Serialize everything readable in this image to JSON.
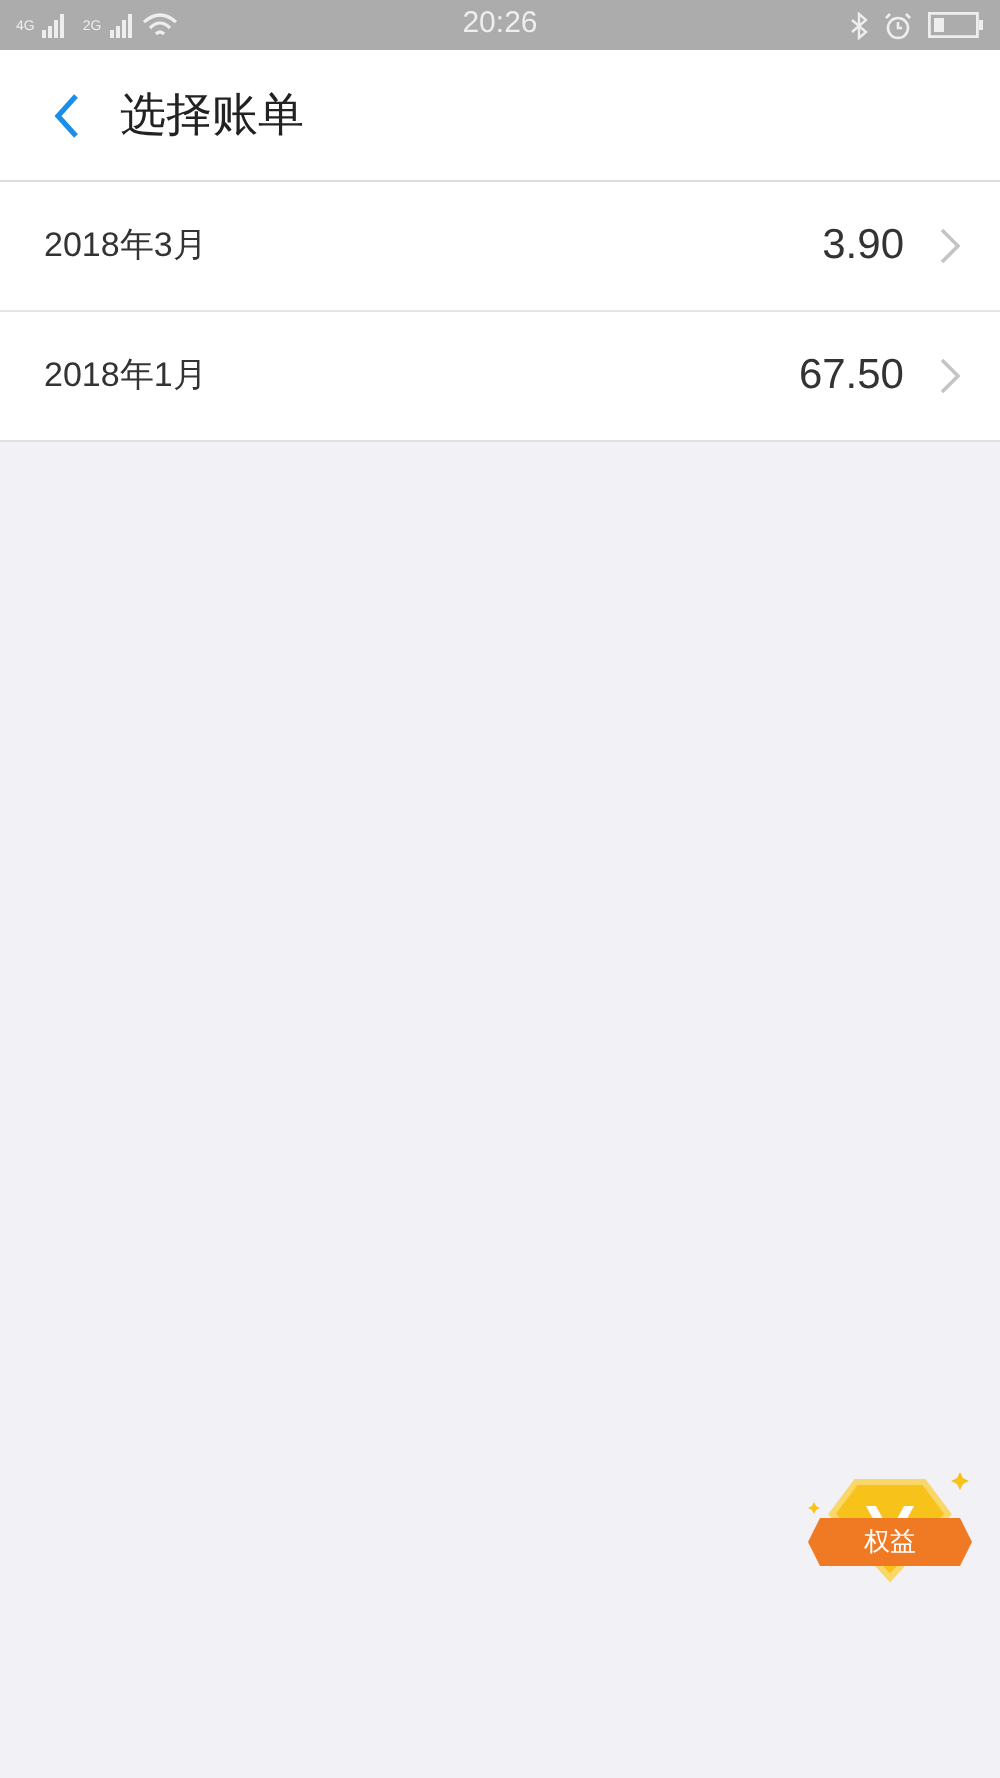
{
  "status_bar": {
    "network_1": "4G",
    "network_2": "2G",
    "time": "20:26"
  },
  "header": {
    "title": "选择账单"
  },
  "bills": [
    {
      "month": "2018年3月",
      "amount": "3.90"
    },
    {
      "month": "2018年1月",
      "amount": "67.50"
    }
  ],
  "benefit_badge": {
    "label": "权益"
  }
}
